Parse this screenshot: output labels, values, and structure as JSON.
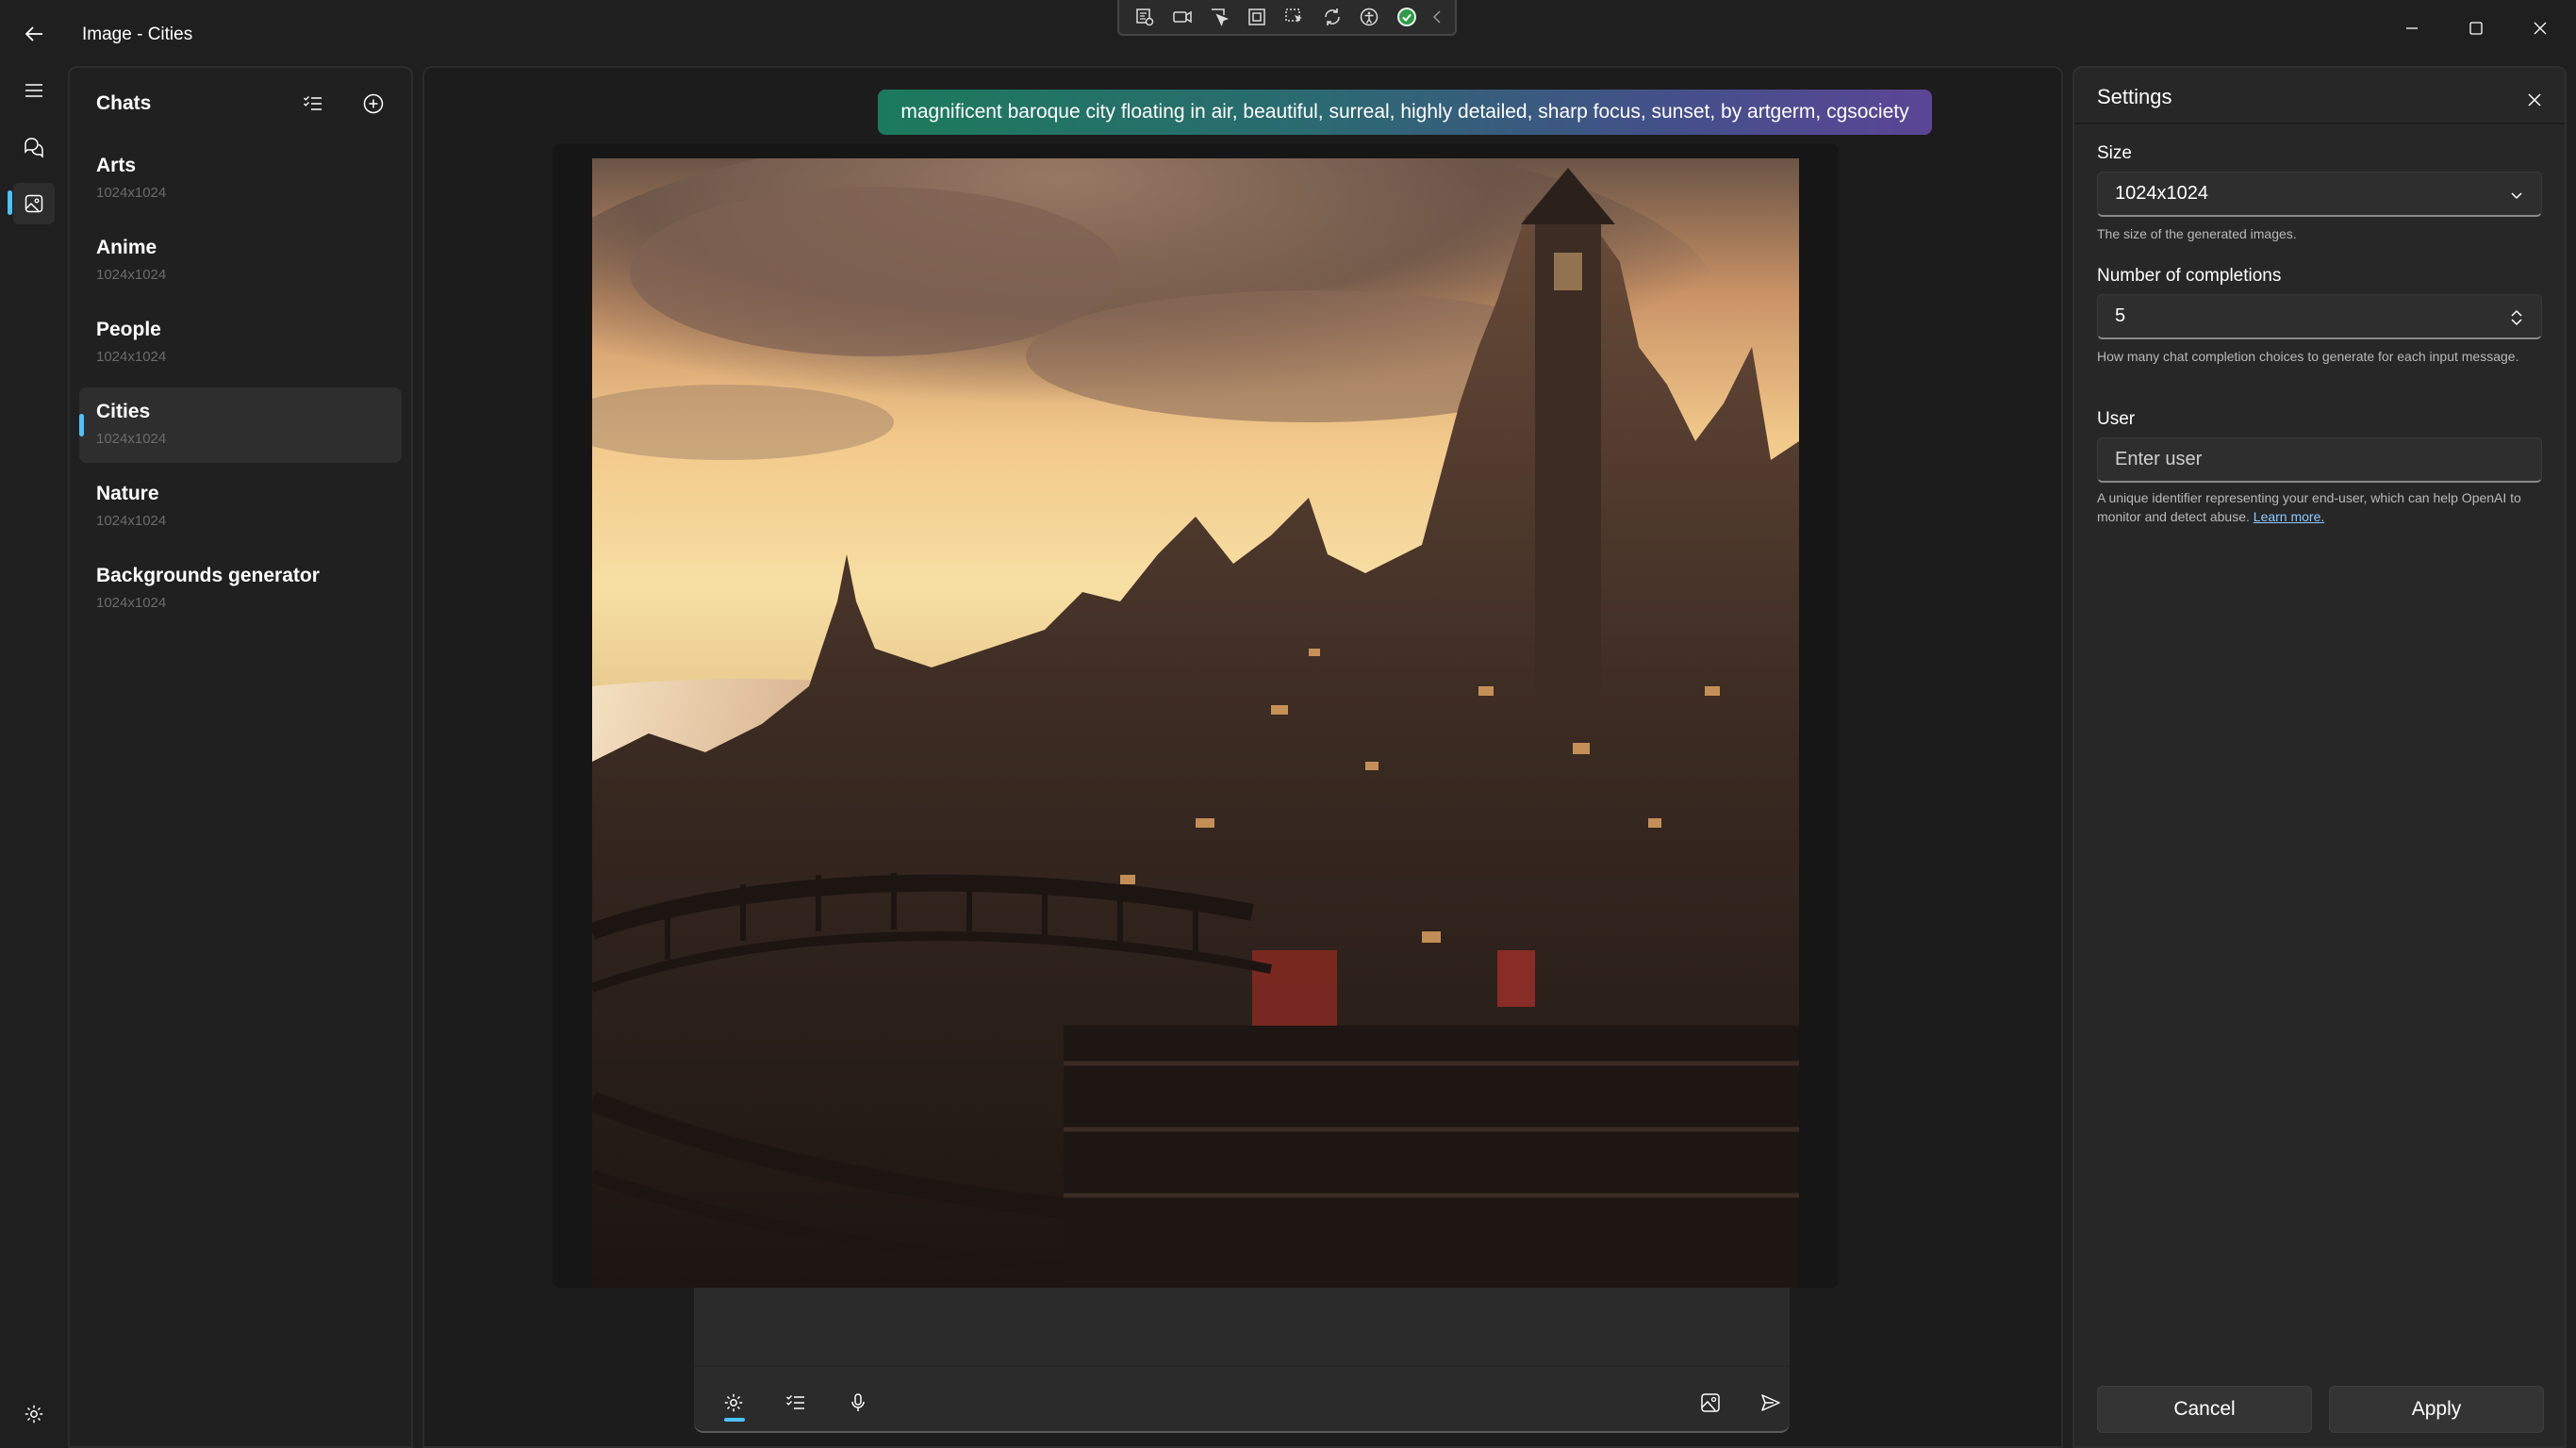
{
  "window": {
    "title": "Image - Cities"
  },
  "dev_toolbar": {
    "icons": [
      "live-visual-tree-icon",
      "record-icon",
      "select-element-icon",
      "display-layout-icon",
      "track-focus-icon",
      "hot-reload-icon",
      "accessibility-icon",
      "check-icon",
      "collapse-icon"
    ]
  },
  "rail": {
    "items": [
      "menu-icon",
      "chats-icon",
      "images-icon",
      "settings-icon"
    ],
    "accent_color": "#4cc2ff"
  },
  "chats": {
    "title": "Chats",
    "items": [
      {
        "name": "Arts",
        "size": "1024x1024"
      },
      {
        "name": "Anime",
        "size": "1024x1024"
      },
      {
        "name": "People",
        "size": "1024x1024"
      },
      {
        "name": "Cities",
        "size": "1024x1024",
        "selected": true
      },
      {
        "name": "Nature",
        "size": "1024x1024"
      },
      {
        "name": "Backgrounds generator",
        "size": "1024x1024"
      }
    ]
  },
  "main": {
    "prompt": "magnificent baroque city floating in air, beautiful, surreal, highly detailed, sharp focus, sunset, by artgerm, cgsociety"
  },
  "settings": {
    "title": "Settings",
    "size_label": "Size",
    "size_value": "1024x1024",
    "size_help": "The size of the generated images.",
    "completions_label": "Number of completions",
    "completions_value": "5",
    "completions_help": "How many chat completion choices to generate for each input message.",
    "user_label": "User",
    "user_placeholder": "Enter user",
    "user_help": "A unique identifier representing your end-user, which can help OpenAI to monitor and detect abuse.",
    "user_help_link": "Learn more.",
    "cancel_label": "Cancel",
    "apply_label": "Apply"
  }
}
